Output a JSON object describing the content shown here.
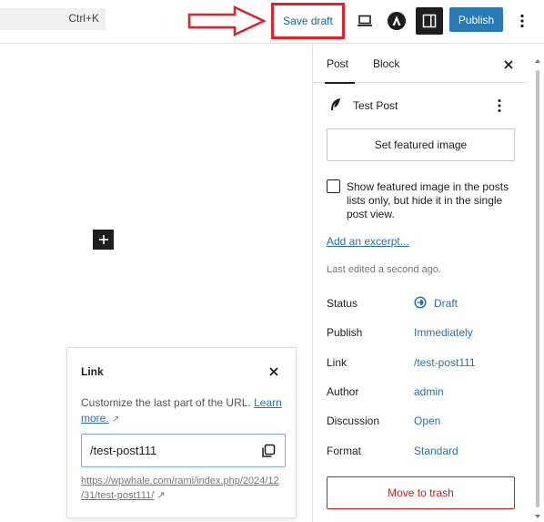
{
  "topbar": {
    "shortcut": "Ctrl+K",
    "save_draft": "Save draft",
    "publish": "Publish",
    "highlight_color": "#e3202b",
    "publish_color": "#2a7bb5"
  },
  "icons": {
    "view": "laptop-icon",
    "astra": "astra-logo-icon",
    "settings": "sidebar-toggle-icon",
    "options": "kebab-menu-icon",
    "add_block": "plus-icon",
    "close": "close-icon",
    "copy": "copy-icon",
    "feather": "feather-icon",
    "draft": "draft-status-icon",
    "arrow": "red-arrow-annotation"
  },
  "link_popover": {
    "title": "Link",
    "description": "Customize the last part of the URL.",
    "learn_more": "Learn more.",
    "external_glyph": "↗",
    "slug": "/test-post111",
    "url_line1": "https://wpwhale.com/rami/index.php/2024/12",
    "url_line2": "/31/test-post111/"
  },
  "sidebar": {
    "tabs": [
      "Post",
      "Block"
    ],
    "post_title": "Test Post",
    "featured_image_button": "Set featured image",
    "checkbox_label": "Show featured image in the posts lists only, but hide it in the single post view.",
    "excerpt_link": "Add an excerpt...",
    "last_edited": "Last edited a second ago.",
    "rows": [
      {
        "key": "Status",
        "value": "Draft"
      },
      {
        "key": "Publish",
        "value": "Immediately"
      },
      {
        "key": "Link",
        "value": "/test-post111"
      },
      {
        "key": "Author",
        "value": "admin"
      },
      {
        "key": "Discussion",
        "value": "Open"
      },
      {
        "key": "Format",
        "value": "Standard"
      }
    ],
    "trash_button": "Move to trash"
  }
}
